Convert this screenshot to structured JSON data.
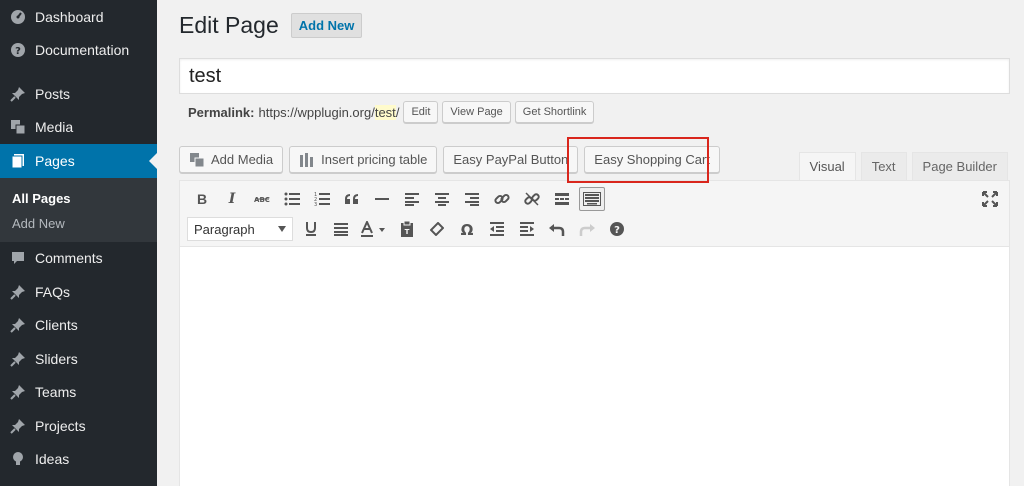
{
  "sidebar": {
    "items": [
      {
        "label": "Dashboard",
        "icon": "dashboard-icon"
      },
      {
        "label": "Documentation",
        "icon": "question-icon"
      },
      {
        "label": "Posts",
        "icon": "pin-icon"
      },
      {
        "label": "Media",
        "icon": "media-icon"
      },
      {
        "label": "Pages",
        "icon": "pages-icon"
      },
      {
        "label": "Comments",
        "icon": "comment-icon"
      },
      {
        "label": "FAQs",
        "icon": "pin-icon"
      },
      {
        "label": "Clients",
        "icon": "pin-icon"
      },
      {
        "label": "Sliders",
        "icon": "pin-icon"
      },
      {
        "label": "Teams",
        "icon": "pin-icon"
      },
      {
        "label": "Projects",
        "icon": "pin-icon"
      },
      {
        "label": "Ideas",
        "icon": "lightbulb-icon"
      }
    ],
    "submenu": [
      {
        "label": "All Pages"
      },
      {
        "label": "Add New"
      }
    ],
    "accent": "#0073aa"
  },
  "header": {
    "title": "Edit Page",
    "add_new": "Add New"
  },
  "post_title": {
    "value": "test"
  },
  "permalink": {
    "label": "Permalink:",
    "base": "https://wpplugin.org/",
    "slug": "test",
    "trail": "/",
    "edit": "Edit",
    "view": "View Page",
    "shortlink": "Get Shortlink"
  },
  "media_buttons": {
    "add_media": "Add Media",
    "pricing": "Insert pricing table",
    "paypal": "Easy PayPal Button",
    "cart": "Easy Shopping Cart"
  },
  "editor_tabs": {
    "visual": "Visual",
    "text": "Text",
    "builder": "Page Builder"
  },
  "toolbar": {
    "format": "Paragraph",
    "bold": "B",
    "italic": "I"
  },
  "highlight_color": "#d9261c"
}
